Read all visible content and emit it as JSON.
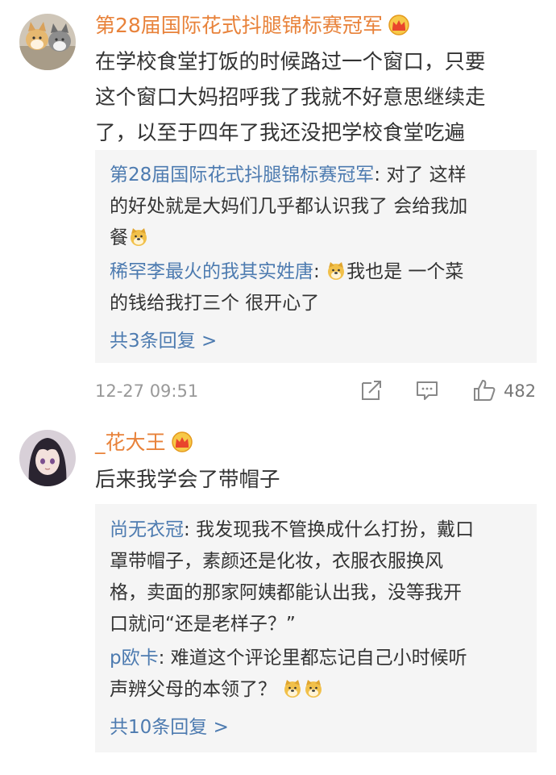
{
  "comments": [
    {
      "username": "第28届国际花式抖腿锦标赛冠军",
      "text_lines": [
        "在学校食堂打饭的时候路过一个窗口，只要",
        "这个窗口大妈招呼我了我就不好意思继续走",
        "了，以至于四年了我还没把学校食堂吃遍"
      ],
      "replies": [
        {
          "author": "第28届国际花式抖腿锦标赛冠军",
          "line1": "对了 这样",
          "line2": "的好处就是大妈们几乎都认识我了 会给我加",
          "line3": "餐"
        },
        {
          "author": "稀罕李最火的我其实姓唐",
          "line1": "我也是 一个菜",
          "line2": "的钱给我打三个 很开心了"
        }
      ],
      "more_replies": "共3条回复 >",
      "timestamp": "12-27 09:51",
      "likes": "482"
    },
    {
      "username": "_花大王",
      "text": "后来我学会了带帽子",
      "replies": [
        {
          "author": "尚无衣冠",
          "line1": "我发现我不管换成什么打扮，戴口",
          "line2": "罩带帽子，素颜还是化妆，衣服衣服换风",
          "line3": "格，卖面的那家阿姨都能认出我，没等我开",
          "line4": "口就问“还是老样子？”"
        },
        {
          "author": "p欧卡",
          "line1": "难道这个评论里都忘记自己小时候听",
          "line2": "声辨父母的本领了？"
        }
      ],
      "more_replies": "共10条回复 >"
    }
  ],
  "icons": {
    "crown": "crown-badge-icon",
    "doge": "doge-emoji-icon",
    "share": "share-icon",
    "comment": "comment-icon",
    "like": "thumbs-up-icon"
  },
  "colors": {
    "username_vip": "#e8823a",
    "username_normal": "#e8823a",
    "reply_author": "#4d7bb0",
    "reply_bg": "#f5f5f5"
  }
}
